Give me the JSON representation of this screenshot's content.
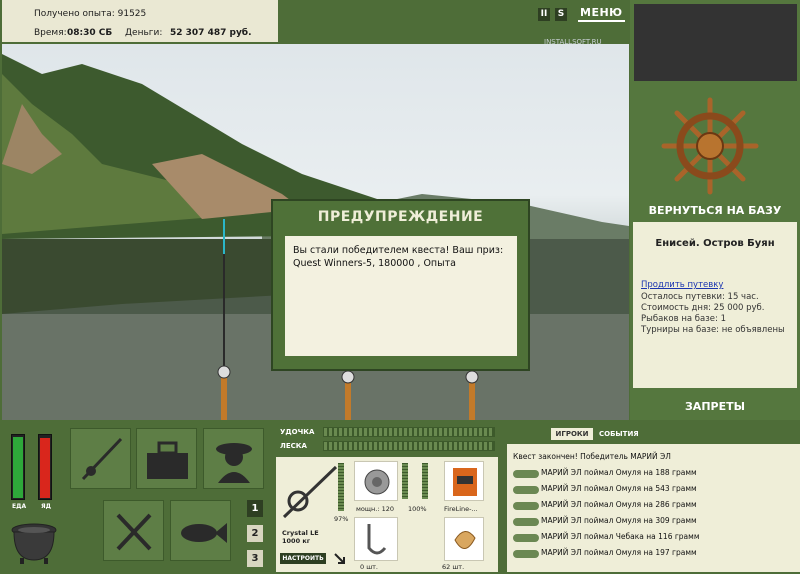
{
  "status": {
    "xp_label": "Получено опыта:",
    "xp_value": "91525",
    "time_label": "Время:",
    "time_value": "08:30 СБ",
    "money_label": "Деньги:",
    "money_value": "52 307 487 руб."
  },
  "topbar": {
    "pause_label": "II",
    "s_label": "S",
    "menu_label": "МЕНЮ",
    "watermark": "INSTALLSOFT.RU"
  },
  "right": {
    "back_label": "ВЕРНУТЬСЯ НА БАЗУ",
    "location": "Енисей. Остров Буян",
    "extend_link": "Продлить путевку",
    "remaining": "Осталось путевки: 15 час.",
    "cost": "Стоимость дня: 25 000 руб.",
    "fishers": "Рыбаков на базе: 1",
    "tournaments": "Турниры на базе: не объявлены",
    "bans_label": "ЗАПРЕТЫ"
  },
  "dialog": {
    "title": "ПРЕДУПРЕЖДЕНИЕ",
    "message": "Вы стали победителем квеста! Ваш приз: Quest Winners-5, 180000 , Опыта"
  },
  "meters": {
    "food_label": "ЕДА",
    "poison_label": "ЯД",
    "food_level": 0.95,
    "poison_level": 0.93
  },
  "numbers": [
    "1",
    "2",
    "3"
  ],
  "gear": {
    "rod_label": "УДОЧКА",
    "line_label": "ЛЕСКА",
    "rod_name": "Crystal LE",
    "rod_weight": "1000 кг",
    "rod_percent": "97%",
    "reel_power": "мощн.: 120",
    "reel_percent": "100%",
    "line_name": "FireLine-...",
    "hooks_count": "0 шт.",
    "bait_count": "62 шт.",
    "tune_label": "НАСТРОИТЬ"
  },
  "log": {
    "tab_players": "ИГРОКИ",
    "tab_events": "СОБЫТИЯ",
    "quest_line": "Квест закончен! Победитель МАРИЙ ЭЛ",
    "entries": [
      "МАРИЙ ЭЛ поймал Омуля на 188 грамм",
      "МАРИЙ ЭЛ поймал Омуля на 543 грамм",
      "МАРИЙ ЭЛ поймал Омуля на 286 грамм",
      "МАРИЙ ЭЛ поймал Омуля на 309 грамм",
      "МАРИЙ ЭЛ поймал Чебака на 116 грамм",
      "МАРИЙ ЭЛ поймал Омуля на 197 грамм"
    ]
  },
  "colors": {
    "panel_green": "#4e6d38",
    "cream": "#efeed8",
    "food_green": "#2ea83a",
    "poison_red": "#d9261c"
  }
}
